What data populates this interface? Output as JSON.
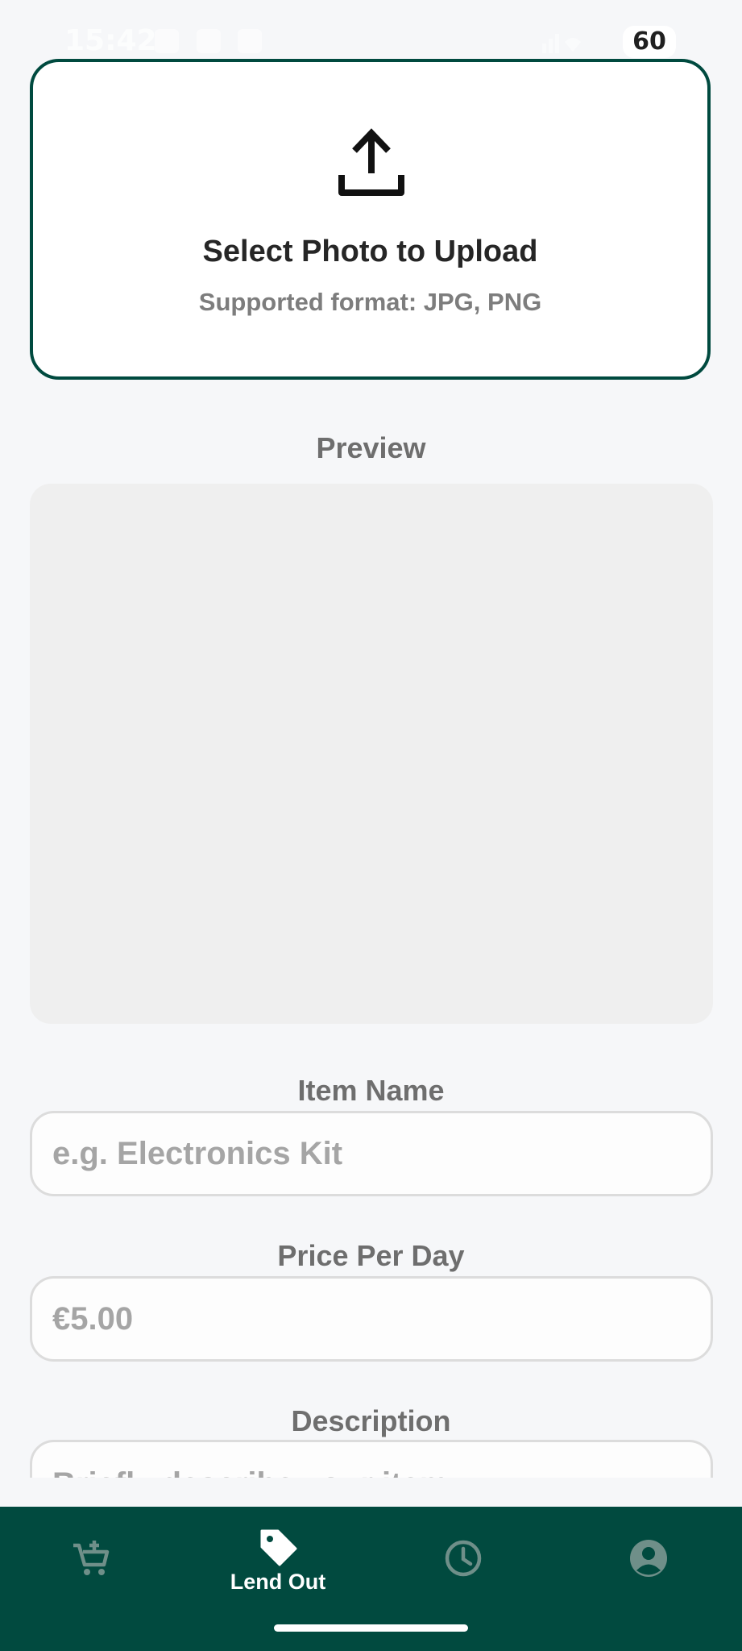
{
  "status_bar": {
    "time": "15:42",
    "battery": "60"
  },
  "upload": {
    "icon": "upload-icon",
    "title": "Select Photo to Upload",
    "subtitle": "Supported format: JPG, PNG"
  },
  "preview": {
    "label": "Preview"
  },
  "form": {
    "item_name": {
      "label": "Item Name",
      "value": "",
      "placeholder": "e.g. Electronics Kit"
    },
    "price_per_day": {
      "label": "Price Per Day",
      "value": "",
      "placeholder": "€5.00"
    },
    "description": {
      "label": "Description",
      "value": "",
      "placeholder": "Briefly describe your item"
    }
  },
  "bottom_nav": {
    "items": [
      {
        "icon": "add-to-cart-icon",
        "label": "",
        "active": false
      },
      {
        "icon": "tag-icon",
        "label": "Lend Out",
        "active": true
      },
      {
        "icon": "clock-icon",
        "label": "",
        "active": false
      },
      {
        "icon": "account-icon",
        "label": "",
        "active": false
      }
    ]
  },
  "colors": {
    "primary": "#014a3f",
    "nav_inactive_icon": "#6f8f89",
    "background": "#f6f7f9"
  }
}
